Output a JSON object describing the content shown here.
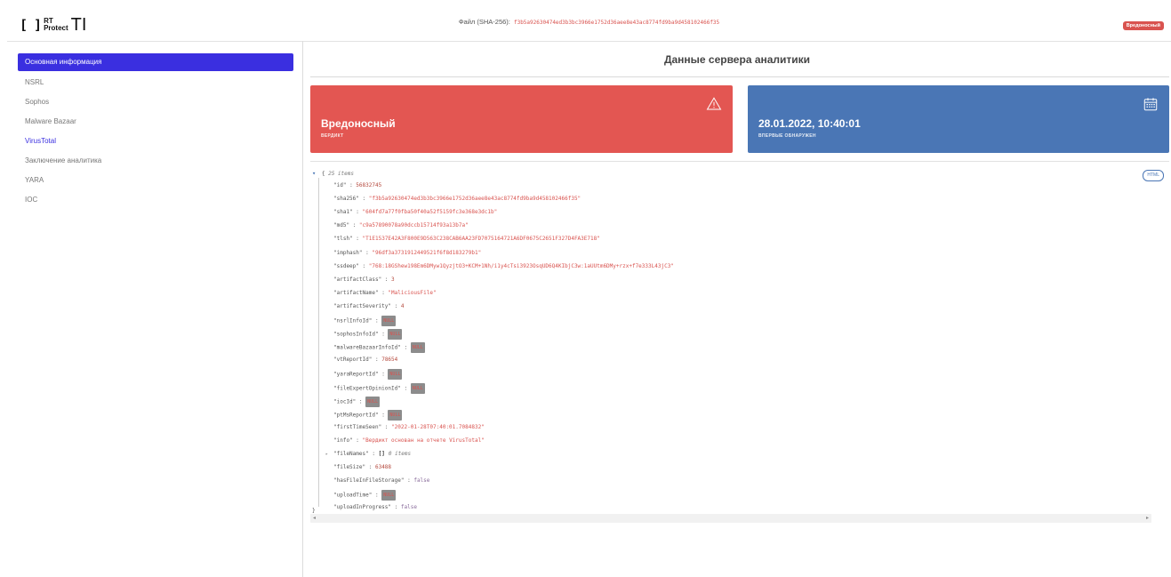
{
  "header": {
    "logo_mark": "[ ]",
    "logo_rt": "RT",
    "logo_protect": "Protect",
    "logo_ti": "TI",
    "file_label": "Файл (SHA-256):",
    "file_hash": "f3b5a92630474ed3b3bc3966e1752d36aee8e43ac8774fd9ba9d458102466f35",
    "verdict_badge": "Вредоносный",
    "badge_color": "#d9534f"
  },
  "sidebar": {
    "items": [
      {
        "label": "Основная информация",
        "state": "active"
      },
      {
        "label": "NSRL"
      },
      {
        "label": "Sophos"
      },
      {
        "label": "Malware Bazaar"
      },
      {
        "label": "VirusTotal",
        "state": "link"
      },
      {
        "label": "Заключение аналитика"
      },
      {
        "label": "YARA"
      },
      {
        "label": "IOC"
      }
    ],
    "accent": "#3a2fe0"
  },
  "main": {
    "title": "Данные сервера аналитики",
    "cards": [
      {
        "value": "Вредоносный",
        "label": "ВЕРДИКТ",
        "icon": "warning-triangle-icon",
        "color": "#e35652"
      },
      {
        "value": "28.01.2022, 10:40:01",
        "label": "ВПЕРВЫЕ ОБНАРУЖЕН",
        "icon": "calendar-icon",
        "color": "#4a76b5"
      }
    ],
    "html_button": "HTML",
    "json": {
      "open_brace": "{",
      "count": "25 items",
      "close_brace": "}",
      "sep": " : ",
      "null_text": "NULL",
      "fields": [
        {
          "key": "\"id\"",
          "value": "56832745",
          "type": "num"
        },
        {
          "key": "\"sha256\"",
          "value": "\"f3b5a92630474ed3b3bc3966e1752d36aee8e43ac8774fd9ba9d458102466f35\"",
          "type": "str"
        },
        {
          "key": "\"sha1\"",
          "value": "\"604fd7a77f0fba50f40a52f5159fc3e368e3dc1b\"",
          "type": "str"
        },
        {
          "key": "\"md5\"",
          "value": "\"c9a57890078a90dccb15714f93a13b7a\"",
          "type": "str"
        },
        {
          "key": "\"tlsh\"",
          "value": "\"T1E1537E42A3F800E9D563C238CAB6AA23FD7075164721A6DF0675C2651F327D4FA3E718\"",
          "type": "str"
        },
        {
          "key": "\"imphash\"",
          "value": "\"96df3a3731912449521f6f8d183279b1\"",
          "type": "str"
        },
        {
          "key": "\"ssdeep\"",
          "value": "\"768:18GShew198Em6DMyw1QyzjtO3+KCM+1Nh/i1y4cTsi3923OsqUD6Q4KIbjC3w:1aUUtm6DMy+rzx+f7e333L43jC3\"",
          "type": "str"
        },
        {
          "key": "\"artifactClass\"",
          "value": "3",
          "type": "num"
        },
        {
          "key": "\"artifactName\"",
          "value": "\"MaliciousFile\"",
          "type": "str"
        },
        {
          "key": "\"artifactSeverity\"",
          "value": "4",
          "type": "num"
        },
        {
          "key": "\"nsrlInfoId\"",
          "value": "",
          "type": "null"
        },
        {
          "key": "\"sophosInfoId\"",
          "value": "",
          "type": "null"
        },
        {
          "key": "\"malwareBazaarInfoId\"",
          "value": "",
          "type": "null"
        },
        {
          "key": "\"vtReportId\"",
          "value": "78654",
          "type": "num"
        },
        {
          "key": "\"yaraReportId\"",
          "value": "",
          "type": "null"
        },
        {
          "key": "\"fileExpertOpinionId\"",
          "value": "",
          "type": "null"
        },
        {
          "key": "\"iocId\"",
          "value": "",
          "type": "null"
        },
        {
          "key": "\"ptMsReportId\"",
          "value": "",
          "type": "null"
        },
        {
          "key": "\"firstTimeSeen\"",
          "value": "\"2022-01-28T07:40:01.7084832\"",
          "type": "str"
        },
        {
          "key": "\"info\"",
          "value": "\"Вердикт основан на отчете VirusTotal\"",
          "type": "str"
        },
        {
          "key": "\"fileNames\"",
          "value": "[]",
          "type": "arr",
          "count": "0 items"
        },
        {
          "key": "\"fileSize\"",
          "value": "63488",
          "type": "num"
        },
        {
          "key": "\"hasFileInFileStorage\"",
          "value": "false",
          "type": "bool"
        },
        {
          "key": "\"uploadTime\"",
          "value": "",
          "type": "null"
        },
        {
          "key": "\"uploadInProgress\"",
          "value": "false",
          "type": "bool"
        }
      ]
    }
  }
}
